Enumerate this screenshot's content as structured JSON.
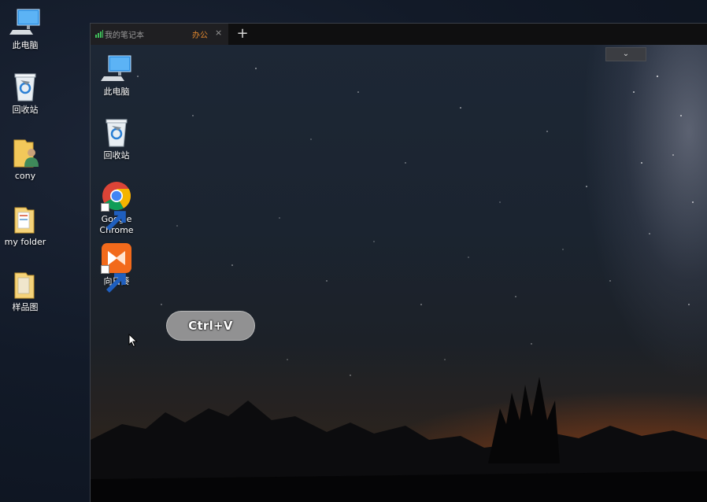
{
  "desktop": {
    "icons": [
      {
        "label": "此电脑",
        "icon": "computer-icon"
      },
      {
        "label": "回收站",
        "icon": "recycle-bin-icon"
      },
      {
        "label": "cony",
        "icon": "user-folder-icon"
      },
      {
        "label": "my folder",
        "icon": "folder-icon"
      },
      {
        "label": "样品图",
        "icon": "folder-icon"
      }
    ]
  },
  "remote": {
    "tab": {
      "device_name": "我的笔记本",
      "group_name": "办公",
      "close_glyph": "×"
    },
    "add_tab_glyph": "+",
    "collapse_glyph": "⌄",
    "desktop_icons": [
      {
        "label": "此电脑",
        "icon": "computer-icon"
      },
      {
        "label": "回收站",
        "icon": "recycle-bin-icon"
      },
      {
        "label_line1": "Google",
        "label_line2": "Chrome",
        "icon": "chrome-icon"
      },
      {
        "label": "向日葵",
        "icon": "sunlogin-icon"
      }
    ]
  },
  "key_hint": "Ctrl+V",
  "colors": {
    "tab_group_accent": "#e68a2e",
    "sunlogin_orange": "#f26a1b"
  }
}
